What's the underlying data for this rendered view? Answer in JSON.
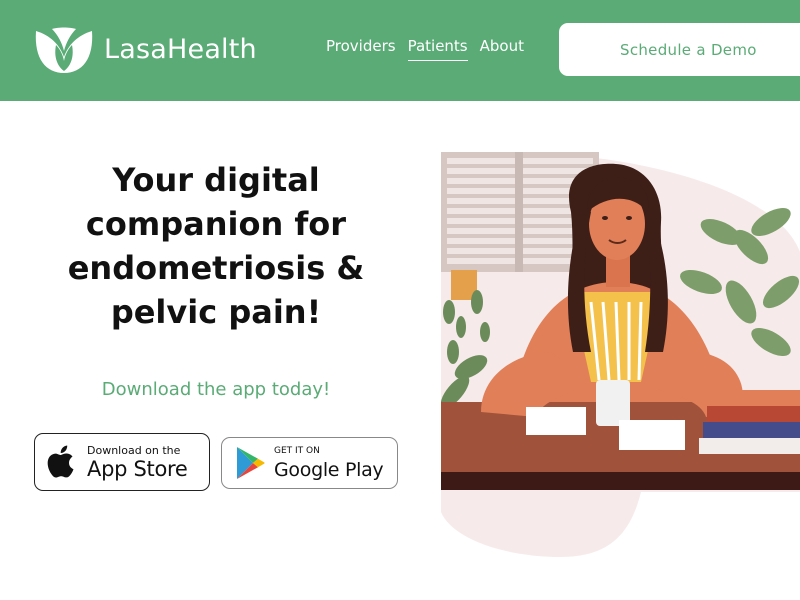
{
  "brand": {
    "name": "LasaHealth"
  },
  "nav": {
    "items": [
      {
        "label": "Providers"
      },
      {
        "label": "Patients"
      },
      {
        "label": "About"
      }
    ],
    "active": "Patients"
  },
  "header": {
    "cta_label": "Schedule a Demo"
  },
  "hero": {
    "headline": "Your digital companion for endometriosis & pelvic pain!",
    "tagline": "Download the app today!"
  },
  "badges": {
    "apple": {
      "small": "Download on the",
      "big": "App Store"
    },
    "google": {
      "small": "GET IT ON",
      "big": "Google Play"
    }
  },
  "colors": {
    "brand_green": "#5aab76",
    "text_dark": "#111111"
  },
  "icons": [
    "leaf-logo-icon",
    "apple-icon",
    "google-play-icon"
  ]
}
